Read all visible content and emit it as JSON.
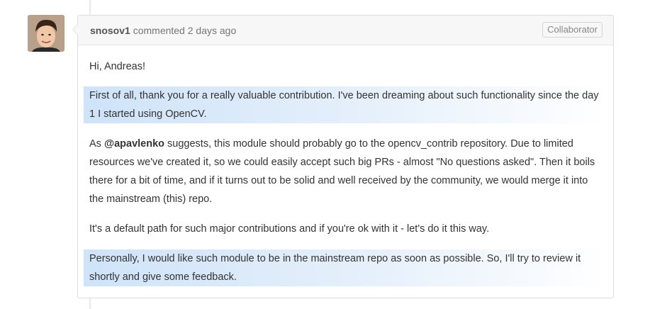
{
  "comment": {
    "author": "snosov1",
    "action": "commented",
    "timestamp": "2 days ago",
    "badge": "Collaborator",
    "greeting": "Hi, Andreas!",
    "p1": "First of all, thank you for a really valuable contribution. I've been dreaming about such functionality since the day 1 I started using OpenCV.",
    "p2_prefix": "As ",
    "p2_mention": "@apavlenko",
    "p2_rest": " suggests, this module should probably go to the opencv_contrib repository. Due to limited resources we've created it, so we could easily accept such big PRs - almost \"No questions asked\". Then it boils there for a bit of time, and if it turns out to be solid and well received by the community, we would merge it into the mainstream (this) repo.",
    "p3": "It's a default path for such major contributions and if you're ok with it - let's do it this way.",
    "p4": "Personally, I would like such module to be in the mainstream repo as soon as possible. So, I'll try to review it shortly and give some feedback."
  },
  "colors": {
    "highlight": "#cfe3f9",
    "header_bg": "#f7f7f7",
    "border": "#dddddd"
  }
}
